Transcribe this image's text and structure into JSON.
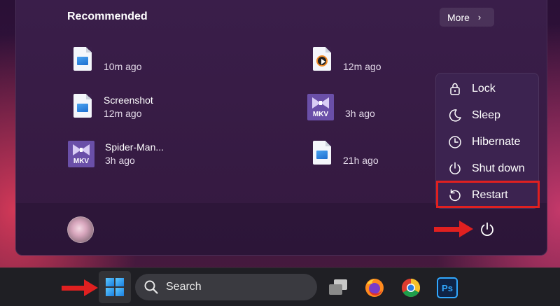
{
  "start_menu": {
    "recommended_title": "Recommended",
    "more_label": "More",
    "items": [
      {
        "name": "",
        "time": "10m ago",
        "icon": "image-file-icon"
      },
      {
        "name": "",
        "time": "12m ago",
        "icon": "media-file-icon"
      },
      {
        "name": "Screenshot",
        "time": "12m ago",
        "icon": "image-file-icon"
      },
      {
        "name": "",
        "time": "3h ago",
        "icon": "mkv-file-icon",
        "icon_label": "MKV"
      },
      {
        "name": "Spider-Man...",
        "time": "3h ago",
        "icon": "mkv-file-icon",
        "icon_label": "MKV"
      },
      {
        "name": "",
        "time": "21h ago",
        "icon": "image-file-icon"
      }
    ]
  },
  "power_menu": {
    "items": [
      {
        "label": "Lock",
        "icon": "lock-icon"
      },
      {
        "label": "Sleep",
        "icon": "moon-icon"
      },
      {
        "label": "Hibernate",
        "icon": "clock-icon"
      },
      {
        "label": "Shut down",
        "icon": "power-icon"
      },
      {
        "label": "Restart",
        "icon": "restart-icon",
        "highlighted": true
      }
    ]
  },
  "taskbar": {
    "search_placeholder": "Search",
    "apps": [
      "task-view-icon",
      "firefox-icon",
      "chrome-icon",
      "photoshop-icon"
    ],
    "photoshop_label": "Ps"
  },
  "colors": {
    "highlight_red": "#e02020",
    "menu_bg": "#3a1e4a",
    "taskbar_bg": "#1f1f24"
  }
}
